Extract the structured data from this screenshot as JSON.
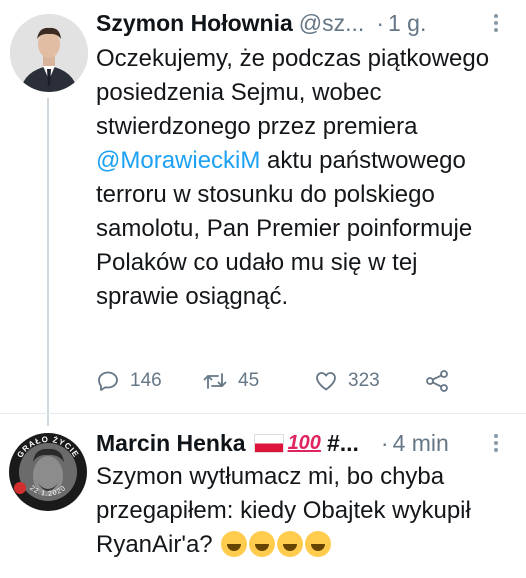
{
  "tweet1": {
    "name": "Szymon Hołownia",
    "handle": "@sz...",
    "time": "1 g.",
    "text_before": "Oczekujemy, że podczas piątkowego posiedzenia Sejmu, wobec stwierdzonego przez premiera ",
    "mention": "@MorawieckiM",
    "text_after": " aktu państwowego terroru w stosunku do polskiego samolotu, Pan Premier poinformuje Polaków co udało mu się w tej sprawie osiągnąć.",
    "replies": "146",
    "retweets": "45",
    "likes": "323"
  },
  "tweet2": {
    "name": "Marcin Henka",
    "name_suffix": "#...",
    "hundred_emoji": "100",
    "time": "4 min",
    "text": "Szymon wytłumacz mi, bo chyba przegapiłem: kiedy Obajtek wykupił RyanAir'a? ",
    "avatar_ring_text_top": "GRAŁO ŻYCIE",
    "avatar_ring_text_bottom": "22.1.2020"
  },
  "icons": {
    "reply": "reply-icon",
    "retweet": "retweet-icon",
    "like": "heart-icon",
    "share": "share-icon",
    "more": "more-vertical-icon",
    "emoji_wink": "winking-tongue-emoji",
    "emoji_laugh": "rolling-laughing-emoji"
  },
  "colors": {
    "accent": "#1da1f2",
    "secondary_text": "#657786",
    "divider": "#e6ecf0",
    "flag_red": "#dc143c"
  }
}
